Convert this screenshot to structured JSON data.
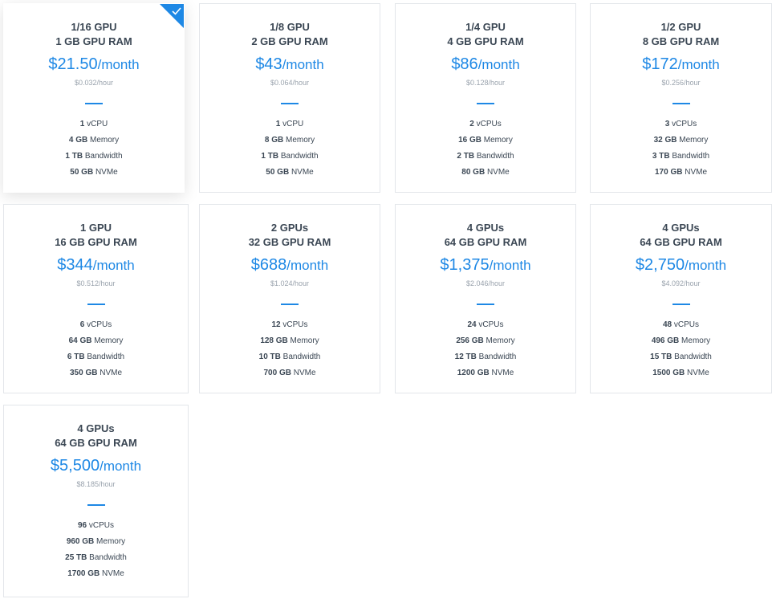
{
  "plans": [
    {
      "gpu": "1/16 GPU",
      "gpu_ram": "1 GB GPU RAM",
      "price": "$21.50",
      "per": "/month",
      "hourly": "$0.032/hour",
      "vcpu_num": "1",
      "vcpu_label": " vCPU",
      "mem_num": "4 GB",
      "mem_label": " Memory",
      "bw_num": "1 TB",
      "bw_label": " Bandwidth",
      "nvme_num": "50 GB",
      "nvme_label": " NVMe",
      "selected": true
    },
    {
      "gpu": "1/8 GPU",
      "gpu_ram": "2 GB GPU RAM",
      "price": "$43",
      "per": "/month",
      "hourly": "$0.064/hour",
      "vcpu_num": "1",
      "vcpu_label": " vCPU",
      "mem_num": "8 GB",
      "mem_label": " Memory",
      "bw_num": "1 TB",
      "bw_label": " Bandwidth",
      "nvme_num": "50 GB",
      "nvme_label": " NVMe"
    },
    {
      "gpu": "1/4 GPU",
      "gpu_ram": "4 GB GPU RAM",
      "price": "$86",
      "per": "/month",
      "hourly": "$0.128/hour",
      "vcpu_num": "2",
      "vcpu_label": " vCPUs",
      "mem_num": "16 GB",
      "mem_label": " Memory",
      "bw_num": "2 TB",
      "bw_label": " Bandwidth",
      "nvme_num": "80 GB",
      "nvme_label": " NVMe"
    },
    {
      "gpu": "1/2 GPU",
      "gpu_ram": "8 GB GPU RAM",
      "price": "$172",
      "per": "/month",
      "hourly": "$0.256/hour",
      "vcpu_num": "3",
      "vcpu_label": " vCPUs",
      "mem_num": "32 GB",
      "mem_label": " Memory",
      "bw_num": "3 TB",
      "bw_label": " Bandwidth",
      "nvme_num": "170 GB",
      "nvme_label": " NVMe"
    },
    {
      "gpu": "1 GPU",
      "gpu_ram": "16 GB GPU RAM",
      "price": "$344",
      "per": "/month",
      "hourly": "$0.512/hour",
      "vcpu_num": "6",
      "vcpu_label": " vCPUs",
      "mem_num": "64 GB",
      "mem_label": " Memory",
      "bw_num": "6 TB",
      "bw_label": " Bandwidth",
      "nvme_num": "350 GB",
      "nvme_label": " NVMe"
    },
    {
      "gpu": "2 GPUs",
      "gpu_ram": "32 GB GPU RAM",
      "price": "$688",
      "per": "/month",
      "hourly": "$1.024/hour",
      "vcpu_num": "12",
      "vcpu_label": " vCPUs",
      "mem_num": "128 GB",
      "mem_label": " Memory",
      "bw_num": "10 TB",
      "bw_label": " Bandwidth",
      "nvme_num": "700 GB",
      "nvme_label": " NVMe"
    },
    {
      "gpu": "4 GPUs",
      "gpu_ram": "64 GB GPU RAM",
      "price": "$1,375",
      "per": "/month",
      "hourly": "$2.046/hour",
      "vcpu_num": "24",
      "vcpu_label": " vCPUs",
      "mem_num": "256 GB",
      "mem_label": " Memory",
      "bw_num": "12 TB",
      "bw_label": " Bandwidth",
      "nvme_num": "1200 GB",
      "nvme_label": " NVMe"
    },
    {
      "gpu": "4 GPUs",
      "gpu_ram": "64 GB GPU RAM",
      "price": "$2,750",
      "per": "/month",
      "hourly": "$4.092/hour",
      "vcpu_num": "48",
      "vcpu_label": " vCPUs",
      "mem_num": "496 GB",
      "mem_label": " Memory",
      "bw_num": "15 TB",
      "bw_label": " Bandwidth",
      "nvme_num": "1500 GB",
      "nvme_label": " NVMe"
    },
    {
      "gpu": "4 GPUs",
      "gpu_ram": "64 GB GPU RAM",
      "price": "$5,500",
      "per": "/month",
      "hourly": "$8.185/hour",
      "vcpu_num": "96",
      "vcpu_label": " vCPUs",
      "mem_num": "960 GB",
      "mem_label": " Memory",
      "bw_num": "25 TB",
      "bw_label": " Bandwidth",
      "nvme_num": "1700 GB",
      "nvme_label": " NVMe"
    }
  ],
  "colors": {
    "accent": "#1e88e5",
    "text": "#3b4754",
    "muted": "#9aa3ad",
    "border": "#e3e6ea"
  },
  "icons": {
    "selected": "check-icon"
  }
}
